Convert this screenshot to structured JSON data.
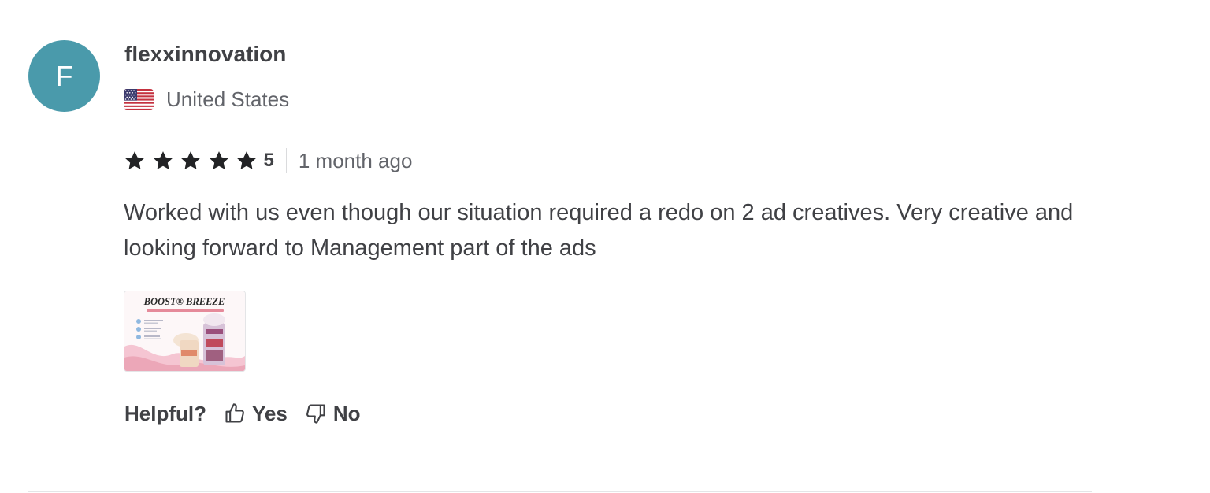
{
  "review": {
    "avatar_letter": "F",
    "avatar_color": "#4a9aab",
    "username": "flexxinnovation",
    "country": "United States",
    "country_flag_icon": "us-flag-icon",
    "rating_value": "5",
    "star_icon": "star-icon",
    "stars_filled": 5,
    "time_ago": "1 month ago",
    "text": "Worked with us even though our situation required a redo on 2 ad creatives. Very creative and looking forward to Management part of the ads",
    "attachment": {
      "title": "BOOST® BREEZE"
    },
    "helpful": {
      "label": "Helpful?",
      "yes_label": "Yes",
      "no_label": "No",
      "yes_icon": "thumbs-up-icon",
      "no_icon": "thumbs-down-icon"
    }
  }
}
